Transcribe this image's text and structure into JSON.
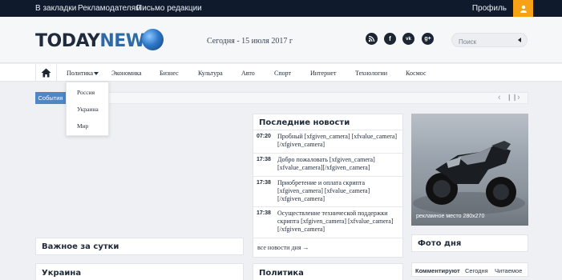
{
  "topbar": {
    "links": [
      "В закладки",
      "Рекламодателям",
      "Письмо редакции"
    ],
    "profile": "Профиль"
  },
  "header": {
    "logo_part1": "TODAY",
    "logo_part2": "NEWS",
    "date": "Сегодня - 15 июля 2017 г",
    "social": [
      "rss-icon",
      "facebook-icon",
      "vk-icon",
      "google-plus-icon"
    ],
    "search_placeholder": "Поиск"
  },
  "nav": {
    "items": [
      "Политика",
      "Экономика",
      "Бизнес",
      "Культура",
      "Авто",
      "Спорт",
      "Интернет",
      "Технологии",
      "Космос"
    ],
    "dropdown": [
      "Россия",
      "Украина",
      "Мир"
    ]
  },
  "ticker": {
    "badge": "События",
    "controls": [
      "‹",
      "❙❙",
      "›"
    ]
  },
  "latest": {
    "title": "Последние новости",
    "items": [
      {
        "time": "07:20",
        "text": "Пробный [xfgiven_camera] [xfvalue_camera][/xfgiven_camera]"
      },
      {
        "time": "17:38",
        "text": "Добро пожаловать [xfgiven_camera] [xfvalue_camera][/xfgiven_camera]"
      },
      {
        "time": "17:38",
        "text": "Приобретение и оплата скрипта [xfgiven_camera] [xfvalue_camera][/xfgiven_camera]"
      },
      {
        "time": "17:38",
        "text": "Осуществление технической поддержки скрипта [xfgiven_camera] [xfvalue_camera][/xfgiven_camera]"
      }
    ],
    "all_link": "все новости дня →"
  },
  "ad": {
    "caption": "рекламное место 280х270"
  },
  "sections": {
    "important": "Важное за сутки",
    "photo": "Фото дня",
    "ukraine": "Украина",
    "politics": "Политика"
  },
  "tabs": [
    "Комментируют",
    "Сегодня",
    "Читаемое"
  ],
  "colors": {
    "topbar": "#0f1b2d",
    "accent_orange": "#f5a216",
    "accent_blue": "#4f86c6",
    "logo_blue": "#2d6aa8"
  }
}
